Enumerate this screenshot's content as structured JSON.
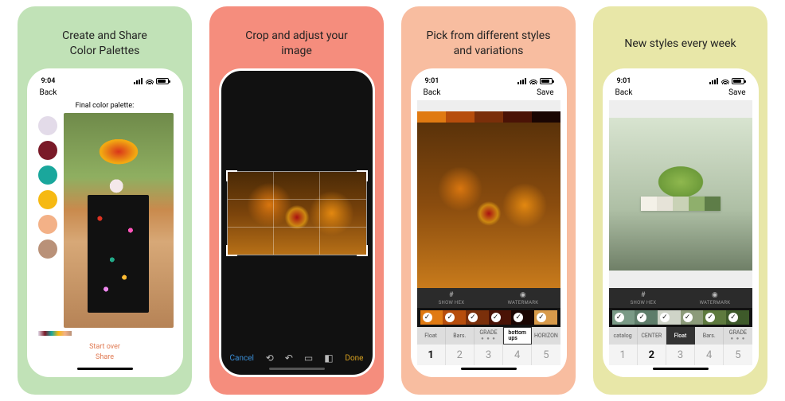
{
  "cards": [
    {
      "bg": "#c1e2b7",
      "title": "Create and Share\nColor Palettes"
    },
    {
      "bg": "#f58d7d",
      "title": "Crop and adjust your\nimage"
    },
    {
      "bg": "#f8bda0",
      "title": "Pick from different styles\nand variations"
    },
    {
      "bg": "#e8e7a8",
      "title": "New styles every week"
    }
  ],
  "screen1": {
    "time": "9:04",
    "back": "Back",
    "header": "Final color palette:",
    "swatches": [
      "#e3dbe9",
      "#7a1a28",
      "#1aa79c",
      "#f6b912",
      "#f3b187",
      "#b99178"
    ],
    "start_over": "Start over",
    "share": "Share"
  },
  "screen2": {
    "cancel": "Cancel",
    "done": "Done",
    "icons": {
      "rotate": "⟲",
      "undo": "↶",
      "aspect": "▭",
      "flip": "◧"
    }
  },
  "screen3": {
    "time": "9:01",
    "back": "Back",
    "save": "Save",
    "strip": [
      "#e07a12",
      "#b64d0c",
      "#7a2f0a",
      "#4a1306",
      "#1a0603"
    ],
    "tool_labels": {
      "hex_icon": "#",
      "hex": "SHOW HEX",
      "wm_icon": "◉",
      "wm": "WATERMARK"
    },
    "checks_bg": [
      "#e07a12",
      "#b64d0c",
      "#7a2f0a",
      "#4a1306",
      "#1a0603",
      "#d89a4a"
    ],
    "style_tabs": [
      {
        "label": "Float",
        "sel": false
      },
      {
        "label": "Bars.",
        "sel": false
      },
      {
        "label": "GRADE",
        "sel": false,
        "dots": true
      },
      {
        "label": "bottom\nups",
        "sel": true
      },
      {
        "label": "HORIZON",
        "sel": false
      }
    ],
    "nums": [
      "1",
      "2",
      "3",
      "4",
      "5"
    ],
    "num_sel": 0
  },
  "screen4": {
    "time": "9:01",
    "back": "Back",
    "save": "Save",
    "overlay_strip": [
      "#f4f1e8",
      "#e6e3d8",
      "#c9d2b6",
      "#8faf6c",
      "#5e7d48"
    ],
    "tool_labels": {
      "hex_icon": "#",
      "hex": "SHOW HEX",
      "wm_icon": "◉",
      "wm": "WATERMARK"
    },
    "checks_bg": [
      "#7a9a86",
      "#5e7d6a",
      "#cfd4c8",
      "#8c9b7a",
      "#5e7a3e",
      "#3e5a2a"
    ],
    "style_tabs": [
      {
        "label": "catalog",
        "sel": false
      },
      {
        "label": "CENTER",
        "sel": false
      },
      {
        "label": "Float",
        "sel": true,
        "dark": true
      },
      {
        "label": "Bars.",
        "sel": false
      },
      {
        "label": "GRADE",
        "sel": false,
        "dots": true
      }
    ],
    "nums": [
      "1",
      "2",
      "3",
      "4",
      "5"
    ],
    "num_sel": 1
  }
}
